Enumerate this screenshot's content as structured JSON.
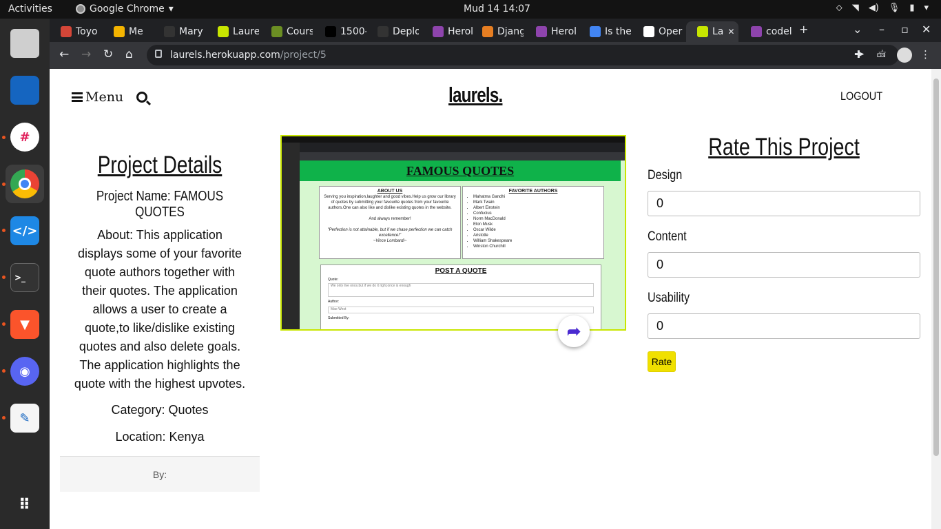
{
  "system": {
    "activities": "Activities",
    "app_name": "Google Chrome",
    "clock": "Mud 14  14:07"
  },
  "browser": {
    "tabs": [
      {
        "label": "Toyo",
        "color": "#d44638"
      },
      {
        "label": "Me",
        "color": "#f4b400"
      },
      {
        "label": "Mary",
        "color": "#333333"
      },
      {
        "label": "Laure",
        "color": "#c8e600"
      },
      {
        "label": "Cours",
        "color": "#6b8e23"
      },
      {
        "label": "1500-",
        "color": "#000000"
      },
      {
        "label": "Deplo",
        "color": "#333333"
      },
      {
        "label": "Herol",
        "color": "#8e44ad"
      },
      {
        "label": "Djang",
        "color": "#e67e22"
      },
      {
        "label": "Herol",
        "color": "#8e44ad"
      },
      {
        "label": "Is the",
        "color": "#4285f4"
      },
      {
        "label": "Oper",
        "color": "#ffffff"
      },
      {
        "label": "La",
        "color": "#c8e600",
        "active": true
      },
      {
        "label": "codel",
        "color": "#8e44ad"
      }
    ],
    "url_host": "laurels.herokuapp.com",
    "url_path": "/project/5"
  },
  "page": {
    "menu_label": "Menu",
    "brand": "laurels.",
    "logout_label": "LOGOUT",
    "details": {
      "heading": "Project Details",
      "project_name": "Project Name: FAMOUS QUOTES",
      "about": "About: This application displays some of your favorite quote authors together with their quotes. The application allows a user to create a quote,to like/dislike existing quotes and also delete goals. The application highlights the quote with the highest upvotes.",
      "category": "Category: Quotes",
      "location": "Location: Kenya",
      "by": "By:"
    },
    "screenshot": {
      "heading": "FAMOUS QUOTES",
      "about_title": "ABOUT US",
      "about_text": "Serving you inspiration,laughter and good vibes.Help us grow our library of quotes by submitting your favourite quotes from your favourite authors.One can also like and dislike existing quotes in the website.",
      "remember": "And always remember!",
      "quote": "\"Perfection is not attainable, but if we chase perfection we can catch excellence!\"",
      "quote_author": "~Vince Lombardi~",
      "authors_title": "FAVORITE AUTHORS",
      "authors": [
        "Mahatma Gandhi",
        "Mark Twain",
        "Albert Einstein",
        "Confucius",
        "Norm MacDonald",
        "Elon Musk",
        "Oscar Wilde",
        "Aristotle",
        "William Shakespeare",
        "Winston Churchill"
      ],
      "post_title": "POST A QUOTE",
      "quote_label": "Quote:",
      "quote_value": "We only live once,but if we do it right,once is enough",
      "author_label": "Author:",
      "author_value": "Mae West",
      "submitted_label": "Submitted By:"
    },
    "rating": {
      "title": "Rate This Project",
      "design_label": "Design",
      "design_value": "0",
      "content_label": "Content",
      "content_value": "0",
      "usability_label": "Usability",
      "usability_value": "0",
      "rate_button": "Rate"
    }
  }
}
